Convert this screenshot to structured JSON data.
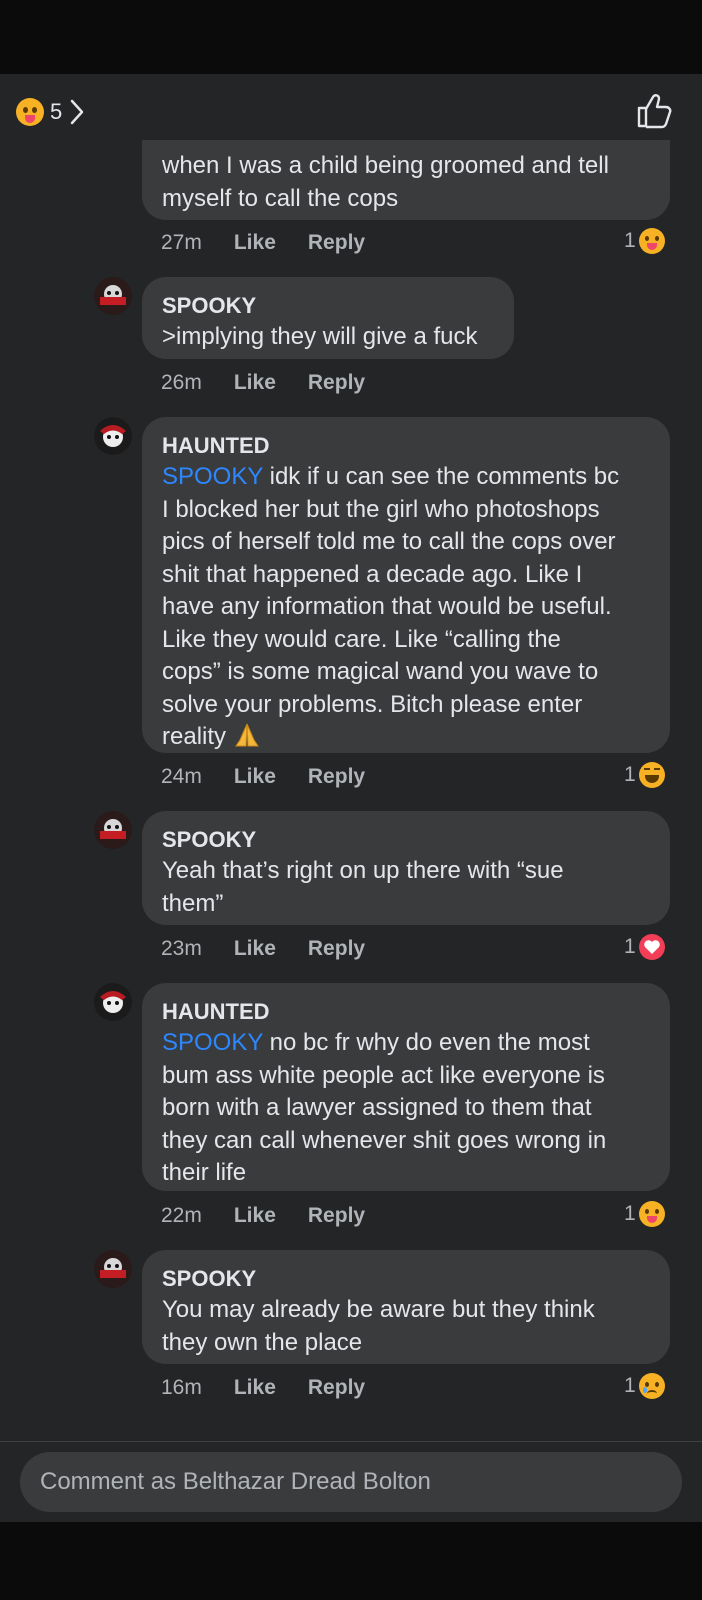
{
  "header": {
    "reaction_count": "5",
    "reaction_icon": "care-emoji-icon",
    "like_icon": "thumbs-up-icon"
  },
  "comments": [
    {
      "author": "",
      "lines": [
        "when I was a child being groomed and tell",
        "myself to call the cops"
      ],
      "time": "27m",
      "like": "Like",
      "reply": "Reply",
      "reaction_count": "1",
      "reaction_icon": "care-emoji-icon"
    },
    {
      "author": "SPOOKY",
      "lines": [
        ">implying they will give a fuck"
      ],
      "time": "26m",
      "like": "Like",
      "reply": "Reply",
      "reaction_count": "",
      "reaction_icon": ""
    },
    {
      "author": "HAUNTED",
      "mention": "SPOOKY",
      "lines": [
        " idk if u can see the comments bc",
        "I blocked her but the girl who photoshops",
        "pics of herself told me to call the cops over",
        "shit that happened a decade ago. Like I",
        "have any information that would be useful.",
        "Like they would care. Like “calling the",
        "cops” is some magical wand you wave to",
        "solve your problems. Bitch please enter",
        "reality"
      ],
      "time": "24m",
      "like": "Like",
      "reply": "Reply",
      "reaction_count": "1",
      "reaction_icon": "haha-emoji-icon"
    },
    {
      "author": "SPOOKY",
      "lines": [
        "Yeah that’s right on up there with “sue",
        "them”"
      ],
      "time": "23m",
      "like": "Like",
      "reply": "Reply",
      "reaction_count": "1",
      "reaction_icon": "love-heart-icon"
    },
    {
      "author": "HAUNTED",
      "mention": "SPOOKY",
      "lines": [
        " no bc fr why do even the most",
        "bum ass white people act like everyone is",
        "born with a lawyer assigned to them that",
        "they can call whenever shit goes wrong in",
        "their life"
      ],
      "time": "22m",
      "like": "Like",
      "reply": "Reply",
      "reaction_count": "1",
      "reaction_icon": "care-emoji-icon"
    },
    {
      "author": "SPOOKY",
      "lines": [
        "You may already be aware but they think",
        "they own the place"
      ],
      "time": "16m",
      "like": "Like",
      "reply": "Reply",
      "reaction_count": "1",
      "reaction_icon": "sad-emoji-icon"
    }
  ],
  "composer": {
    "placeholder": "Comment as Belthazar Dread Bolton"
  },
  "colors": {
    "background": "#242526",
    "bubble": "#3a3b3c",
    "mention": "#2d88ff",
    "muted": "#b0b3b8"
  }
}
